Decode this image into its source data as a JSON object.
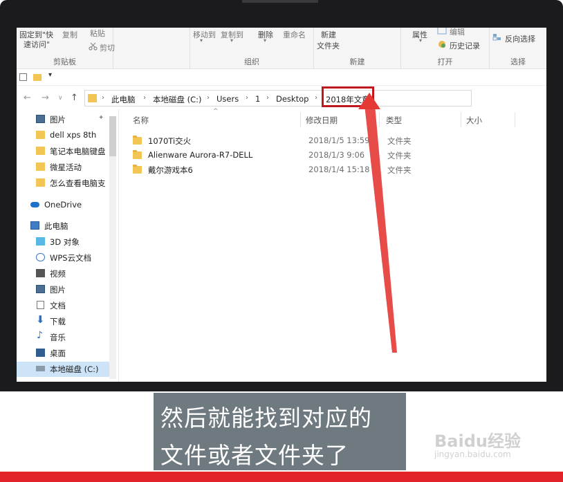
{
  "ribbon": {
    "clipboard": {
      "pin_label": "固定到\"快\n速访问\"",
      "copy_label": "复制",
      "paste_label": "粘贴",
      "cut_label": "剪切",
      "group_title": "剪贴板"
    },
    "organize": {
      "move_to_label": "移动到",
      "copy_to_label": "复制到",
      "delete_label": "删除",
      "rename_label": "重命名",
      "group_title": "组织"
    },
    "new": {
      "new_folder_line1": "新建",
      "new_folder_line2": "文件夹",
      "group_title": "新建"
    },
    "open": {
      "properties_label": "属性",
      "edit_label": "编辑",
      "history_label": "历史记录",
      "group_title": "打开"
    },
    "select": {
      "invert_label": "反向选择",
      "group_title": "选择"
    }
  },
  "breadcrumb": [
    "此电脑",
    "本地磁盘 (C:)",
    "Users",
    "1",
    "Desktop",
    "2018年文章"
  ],
  "sidebar": {
    "items": [
      {
        "label": "图片",
        "icon": "picture-icon"
      },
      {
        "label": "dell xps 8th",
        "icon": "folder-icon"
      },
      {
        "label": "笔记本电脑键盘",
        "icon": "folder-icon"
      },
      {
        "label": "微星活动",
        "icon": "folder-icon"
      },
      {
        "label": "怎么查看电脑支",
        "icon": "folder-icon"
      },
      {
        "label": "OneDrive",
        "icon": "cloud-icon"
      },
      {
        "label": "此电脑",
        "icon": "computer-icon"
      },
      {
        "label": "3D 对象",
        "icon": "cube-icon"
      },
      {
        "label": "WPS云文档",
        "icon": "wps-cloud-icon"
      },
      {
        "label": "视频",
        "icon": "video-icon"
      },
      {
        "label": "图片",
        "icon": "picture-icon"
      },
      {
        "label": "文档",
        "icon": "document-icon"
      },
      {
        "label": "下载",
        "icon": "download-icon"
      },
      {
        "label": "音乐",
        "icon": "music-icon"
      },
      {
        "label": "桌面",
        "icon": "desktop-icon"
      },
      {
        "label": "本地磁盘 (C:)",
        "icon": "drive-icon"
      }
    ]
  },
  "columns": {
    "name": "名称",
    "modified": "修改日期",
    "type": "类型",
    "size": "大小"
  },
  "files": [
    {
      "name": "1070Ti交火",
      "modified": "2018/1/5 13:59",
      "type": "文件夹"
    },
    {
      "name": "Alienware Aurora-R7-DELL",
      "modified": "2018/1/3 9:06",
      "type": "文件夹"
    },
    {
      "name": "戴尔游戏本6",
      "modified": "2018/1/4 15:18",
      "type": "文件夹"
    }
  ],
  "caption": {
    "line1": "然后就能找到对应的",
    "line2": "文件或者文件夹了"
  },
  "watermark": {
    "brand": "Baidu经验",
    "url": "jingyan.baidu.com"
  },
  "colors": {
    "highlight": "#c0171c",
    "arrow": "#e53935",
    "caption_bg": "#6f7a80",
    "bottom_bar": "#e3232a"
  }
}
